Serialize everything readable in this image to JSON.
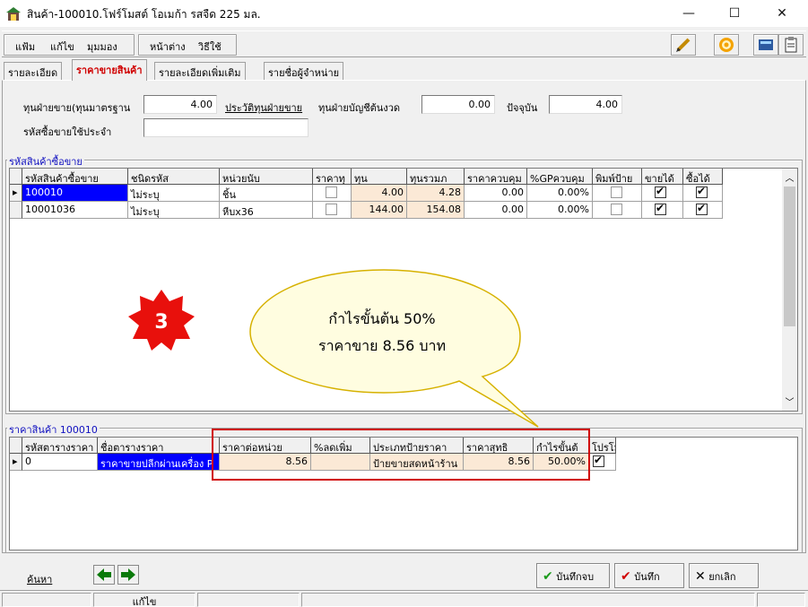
{
  "window": {
    "title": "สินค้า-100010.โฟร์โมสต์ โอเมก้า รสจืด 225  มล.",
    "minimize": "—",
    "maximize": "☐",
    "close": "✕"
  },
  "menu": {
    "file": "แฟ้ม",
    "edit": "แก้ไข",
    "view": "มุมมอง",
    "window": "หน้าต่าง",
    "help": "วิธีใช้"
  },
  "tabs": [
    {
      "label": "รายละเอียด"
    },
    {
      "label": "ราคาขายสินค้า"
    },
    {
      "label": "รายละเอียดเพิ่มเติม"
    },
    {
      "label": "รายชื่อผู้จำหน่าย"
    }
  ],
  "cost": {
    "standard_label": "ทุนฝ่ายขาย(ทุนมาตรฐาน",
    "standard_value": "4.00",
    "history_link": "ประวัติทุนฝ่ายขาย",
    "initial_label": "ทุนฝ่ายบัญชีต้นงวด",
    "initial_value": "0.00",
    "current_label": "ปัจจุบัน",
    "current_value": "4.00",
    "default_code_label": "รหัสซื้อขายใช้ประจำ",
    "default_code_value": ""
  },
  "barcode_group": {
    "title": "รหัสสินค้าซื้อขาย",
    "headers": [
      "รหัสสินค้าซื้อขาย",
      "ชนิดรหัส",
      "หน่วยนับ",
      "ราคาทุ",
      "ทุน",
      "ทุนรวมภ",
      "ราคาควบคุม",
      "%GPควบคุม",
      "พิมพ์ป้าย",
      "ขายได้",
      "ซื้อได้"
    ],
    "rows": [
      {
        "code": "100010",
        "type": "ไม่ระบุ",
        "unit": "ชิ้น",
        "cost": "4.00",
        "cost_vat": "4.28",
        "control_price": "0.00",
        "gp": "0.00%",
        "sellable": true,
        "buyable": true
      },
      {
        "code": "10001036",
        "type": "ไม่ระบุ",
        "unit": "หีบx36",
        "cost": "144.00",
        "cost_vat": "154.08",
        "control_price": "0.00",
        "gp": "0.00%",
        "sellable": true,
        "buyable": true
      }
    ]
  },
  "annotation": {
    "step": "3",
    "line1": "กำไรขั้นต้น 50%",
    "line2": "ราคาขาย 8.56 บาท"
  },
  "price_group": {
    "title": "ราคาสินค้า 100010",
    "headers": [
      "รหัสตารางราคา",
      "ชื่อตารางราคา",
      "ราคาต่อหน่วย",
      "%ลดเพิ่ม",
      "ประเภทป้ายราคา",
      "ราคาสุทธิ",
      "กำไรขั้นต้",
      "โปรโม"
    ],
    "rows": [
      {
        "code": "0",
        "name": "ราคาขายปลีกผ่านเครื่อง P",
        "unit_price": "8.56",
        "discount": "",
        "label_type": "ป้ายขายสดหน้าร้าน",
        "net_price": "8.56",
        "gross_profit": "50.00%",
        "promo": true
      }
    ]
  },
  "bottom": {
    "search": "ค้นหา",
    "save_close": "บันทึกจบ",
    "save": "บันทึก",
    "cancel": "ยกเลิก"
  },
  "status": {
    "mode": "แก้ไข"
  },
  "colors": {
    "active_tab": "#d00000",
    "group_title": "#1010c0",
    "selection": "#0000ff",
    "peach_cell": "#fbe9d6",
    "highlight": "#d00000",
    "bubble_fill": "#fffde0",
    "bubble_stroke": "#d6b100"
  }
}
